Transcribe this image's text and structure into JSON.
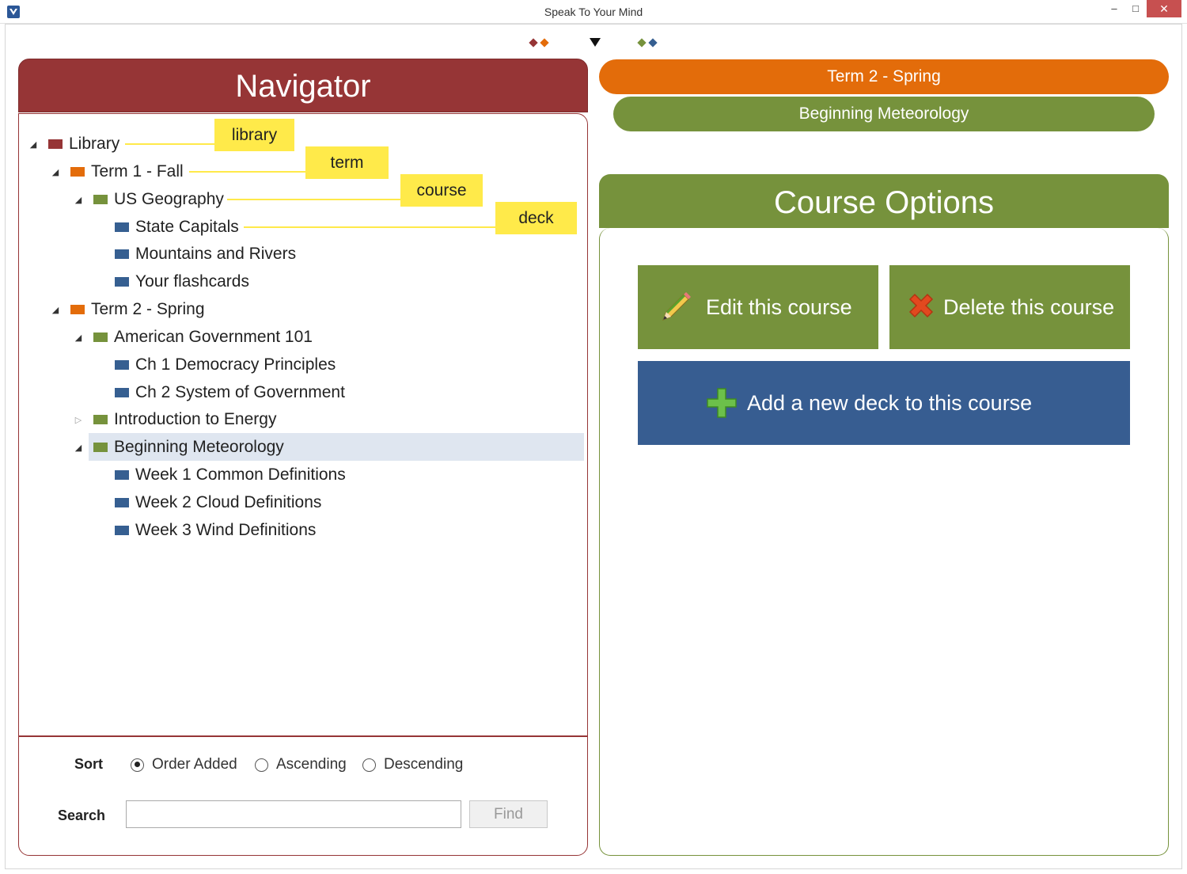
{
  "window": {
    "title": "Speak To Your Mind",
    "minimize_glyph": "–",
    "maximize_glyph": "□",
    "close_glyph": "✕"
  },
  "colors": {
    "library": "#963536",
    "term": "#e36c0a",
    "course": "#76923c",
    "deck": "#365f91"
  },
  "navigator": {
    "title": "Navigator",
    "tree": [
      {
        "label": "Library",
        "level": "library",
        "expanded": true
      },
      {
        "label": "Term 1 - Fall",
        "level": "term",
        "expanded": true
      },
      {
        "label": "US Geography",
        "level": "course",
        "expanded": true
      },
      {
        "label": "State Capitals",
        "level": "deck"
      },
      {
        "label": "Mountains and Rivers",
        "level": "deck"
      },
      {
        "label": "Your flashcards",
        "level": "deck"
      },
      {
        "label": "Term 2 - Spring",
        "level": "term",
        "expanded": true
      },
      {
        "label": "American Government 101",
        "level": "course",
        "expanded": true
      },
      {
        "label": "Ch 1 Democracy Principles",
        "level": "deck"
      },
      {
        "label": "Ch 2 System of Government",
        "level": "deck"
      },
      {
        "label": "Introduction to Energy",
        "level": "course",
        "expanded": false
      },
      {
        "label": "Beginning Meteorology",
        "level": "course",
        "expanded": true,
        "selected": true
      },
      {
        "label": "Week 1 Common Definitions",
        "level": "deck"
      },
      {
        "label": "Week 2 Cloud Definitions",
        "level": "deck"
      },
      {
        "label": "Week 3 Wind Definitions",
        "level": "deck"
      }
    ],
    "callouts": [
      "library",
      "term",
      "course",
      "deck"
    ],
    "sort": {
      "label": "Sort",
      "options": [
        "Order Added",
        "Ascending",
        "Descending"
      ],
      "selected": "Order Added"
    },
    "search": {
      "label": "Search",
      "value": "",
      "find_label": "Find"
    }
  },
  "breadcrumb": {
    "term": "Term 2 - Spring",
    "course": "Beginning Meteorology"
  },
  "course_options": {
    "title": "Course Options",
    "edit_label": "Edit this course",
    "delete_label": "Delete this course",
    "add_deck_label": "Add a new deck to this course",
    "edit_icon": "pencil-icon",
    "delete_icon": "red-x-icon",
    "add_icon": "green-plus-icon"
  },
  "expander_icons": {
    "expanded": "◢",
    "collapsed": "▷"
  }
}
